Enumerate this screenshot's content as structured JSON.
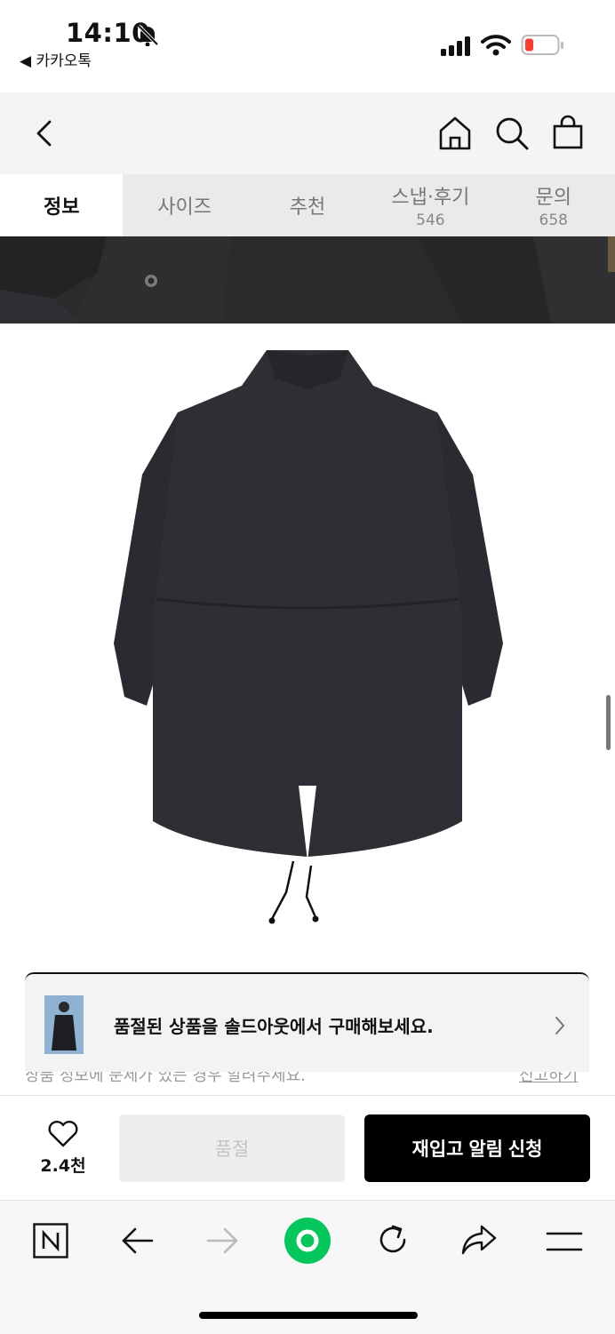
{
  "status_bar": {
    "time": "14:10",
    "back_app": "◀ 카카오톡"
  },
  "tabs": [
    {
      "label": "정보",
      "count": ""
    },
    {
      "label": "사이즈",
      "count": ""
    },
    {
      "label": "추천",
      "count": ""
    },
    {
      "label": "스냅·후기",
      "count": "546"
    },
    {
      "label": "문의",
      "count": "658"
    }
  ],
  "banner": {
    "text": "품절된 상품을 솔드아웃에서 구매해보세요."
  },
  "faded_notice": {
    "text": "상품 정보에 문제가 있는 경우 알려주세요.",
    "link": "신고하기"
  },
  "buy_bar": {
    "like_count": "2.4천",
    "soldout_label": "품절",
    "restock_label": "재입고 알림 신청"
  },
  "icons": [
    "back-icon",
    "home-icon",
    "search-icon",
    "cart-icon",
    "heart-icon",
    "chevron-right-icon",
    "naver-icon",
    "browser-back-icon",
    "browser-forward-icon",
    "green-dot-icon",
    "refresh-icon",
    "share-icon",
    "menu-icon"
  ],
  "colors": {
    "accent_green": "#03c75a",
    "battery_low": "#ff3b30"
  }
}
